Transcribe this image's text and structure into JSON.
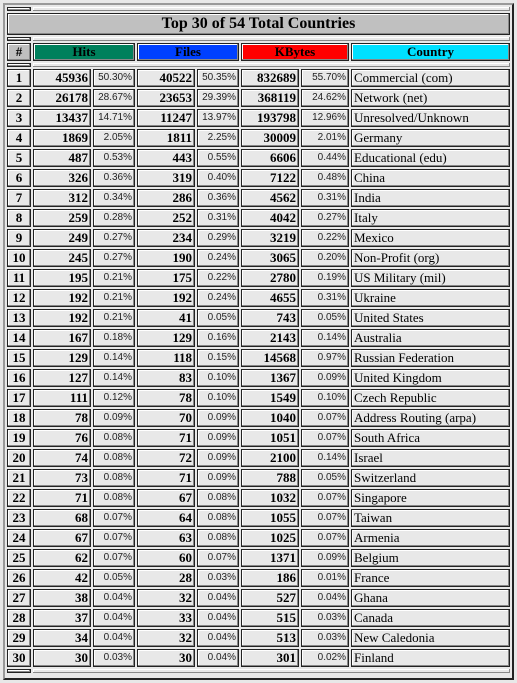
{
  "title": "Top 30 of 54 Total Countries",
  "headers": {
    "rank": "#",
    "hits": "Hits",
    "files": "Files",
    "kbytes": "KBytes",
    "country": "Country"
  },
  "colors": {
    "title_bg": "#C0C0C0",
    "hits": "#00805C",
    "files": "#0040FF",
    "kbytes": "#FF0000",
    "country": "#00E0FF"
  },
  "rows": [
    {
      "rank": "1",
      "hits": "45936",
      "hits_pct": "50.30%",
      "files": "40522",
      "files_pct": "50.35%",
      "kbytes": "832689",
      "kbytes_pct": "55.70%",
      "country": "Commercial (com)"
    },
    {
      "rank": "2",
      "hits": "26178",
      "hits_pct": "28.67%",
      "files": "23653",
      "files_pct": "29.39%",
      "kbytes": "368119",
      "kbytes_pct": "24.62%",
      "country": "Network (net)"
    },
    {
      "rank": "3",
      "hits": "13437",
      "hits_pct": "14.71%",
      "files": "11247",
      "files_pct": "13.97%",
      "kbytes": "193798",
      "kbytes_pct": "12.96%",
      "country": "Unresolved/Unknown"
    },
    {
      "rank": "4",
      "hits": "1869",
      "hits_pct": "2.05%",
      "files": "1811",
      "files_pct": "2.25%",
      "kbytes": "30009",
      "kbytes_pct": "2.01%",
      "country": "Germany"
    },
    {
      "rank": "5",
      "hits": "487",
      "hits_pct": "0.53%",
      "files": "443",
      "files_pct": "0.55%",
      "kbytes": "6606",
      "kbytes_pct": "0.44%",
      "country": "Educational (edu)"
    },
    {
      "rank": "6",
      "hits": "326",
      "hits_pct": "0.36%",
      "files": "319",
      "files_pct": "0.40%",
      "kbytes": "7122",
      "kbytes_pct": "0.48%",
      "country": "China"
    },
    {
      "rank": "7",
      "hits": "312",
      "hits_pct": "0.34%",
      "files": "286",
      "files_pct": "0.36%",
      "kbytes": "4562",
      "kbytes_pct": "0.31%",
      "country": "India"
    },
    {
      "rank": "8",
      "hits": "259",
      "hits_pct": "0.28%",
      "files": "252",
      "files_pct": "0.31%",
      "kbytes": "4042",
      "kbytes_pct": "0.27%",
      "country": "Italy"
    },
    {
      "rank": "9",
      "hits": "249",
      "hits_pct": "0.27%",
      "files": "234",
      "files_pct": "0.29%",
      "kbytes": "3219",
      "kbytes_pct": "0.22%",
      "country": "Mexico"
    },
    {
      "rank": "10",
      "hits": "245",
      "hits_pct": "0.27%",
      "files": "190",
      "files_pct": "0.24%",
      "kbytes": "3065",
      "kbytes_pct": "0.20%",
      "country": "Non-Profit (org)"
    },
    {
      "rank": "11",
      "hits": "195",
      "hits_pct": "0.21%",
      "files": "175",
      "files_pct": "0.22%",
      "kbytes": "2780",
      "kbytes_pct": "0.19%",
      "country": "US Military (mil)"
    },
    {
      "rank": "12",
      "hits": "192",
      "hits_pct": "0.21%",
      "files": "192",
      "files_pct": "0.24%",
      "kbytes": "4655",
      "kbytes_pct": "0.31%",
      "country": "Ukraine"
    },
    {
      "rank": "13",
      "hits": "192",
      "hits_pct": "0.21%",
      "files": "41",
      "files_pct": "0.05%",
      "kbytes": "743",
      "kbytes_pct": "0.05%",
      "country": "United States"
    },
    {
      "rank": "14",
      "hits": "167",
      "hits_pct": "0.18%",
      "files": "129",
      "files_pct": "0.16%",
      "kbytes": "2143",
      "kbytes_pct": "0.14%",
      "country": "Australia"
    },
    {
      "rank": "15",
      "hits": "129",
      "hits_pct": "0.14%",
      "files": "118",
      "files_pct": "0.15%",
      "kbytes": "14568",
      "kbytes_pct": "0.97%",
      "country": "Russian Federation"
    },
    {
      "rank": "16",
      "hits": "127",
      "hits_pct": "0.14%",
      "files": "83",
      "files_pct": "0.10%",
      "kbytes": "1367",
      "kbytes_pct": "0.09%",
      "country": "United Kingdom"
    },
    {
      "rank": "17",
      "hits": "111",
      "hits_pct": "0.12%",
      "files": "78",
      "files_pct": "0.10%",
      "kbytes": "1549",
      "kbytes_pct": "0.10%",
      "country": "Czech Republic"
    },
    {
      "rank": "18",
      "hits": "78",
      "hits_pct": "0.09%",
      "files": "70",
      "files_pct": "0.09%",
      "kbytes": "1040",
      "kbytes_pct": "0.07%",
      "country": "Address Routing (arpa)"
    },
    {
      "rank": "19",
      "hits": "76",
      "hits_pct": "0.08%",
      "files": "71",
      "files_pct": "0.09%",
      "kbytes": "1051",
      "kbytes_pct": "0.07%",
      "country": "South Africa"
    },
    {
      "rank": "20",
      "hits": "74",
      "hits_pct": "0.08%",
      "files": "72",
      "files_pct": "0.09%",
      "kbytes": "2100",
      "kbytes_pct": "0.14%",
      "country": "Israel"
    },
    {
      "rank": "21",
      "hits": "73",
      "hits_pct": "0.08%",
      "files": "71",
      "files_pct": "0.09%",
      "kbytes": "788",
      "kbytes_pct": "0.05%",
      "country": "Switzerland"
    },
    {
      "rank": "22",
      "hits": "71",
      "hits_pct": "0.08%",
      "files": "67",
      "files_pct": "0.08%",
      "kbytes": "1032",
      "kbytes_pct": "0.07%",
      "country": "Singapore"
    },
    {
      "rank": "23",
      "hits": "68",
      "hits_pct": "0.07%",
      "files": "64",
      "files_pct": "0.08%",
      "kbytes": "1055",
      "kbytes_pct": "0.07%",
      "country": "Taiwan"
    },
    {
      "rank": "24",
      "hits": "67",
      "hits_pct": "0.07%",
      "files": "63",
      "files_pct": "0.08%",
      "kbytes": "1025",
      "kbytes_pct": "0.07%",
      "country": "Armenia"
    },
    {
      "rank": "25",
      "hits": "62",
      "hits_pct": "0.07%",
      "files": "60",
      "files_pct": "0.07%",
      "kbytes": "1371",
      "kbytes_pct": "0.09%",
      "country": "Belgium"
    },
    {
      "rank": "26",
      "hits": "42",
      "hits_pct": "0.05%",
      "files": "28",
      "files_pct": "0.03%",
      "kbytes": "186",
      "kbytes_pct": "0.01%",
      "country": "France"
    },
    {
      "rank": "27",
      "hits": "38",
      "hits_pct": "0.04%",
      "files": "32",
      "files_pct": "0.04%",
      "kbytes": "527",
      "kbytes_pct": "0.04%",
      "country": "Ghana"
    },
    {
      "rank": "28",
      "hits": "37",
      "hits_pct": "0.04%",
      "files": "33",
      "files_pct": "0.04%",
      "kbytes": "515",
      "kbytes_pct": "0.03%",
      "country": "Canada"
    },
    {
      "rank": "29",
      "hits": "34",
      "hits_pct": "0.04%",
      "files": "32",
      "files_pct": "0.04%",
      "kbytes": "513",
      "kbytes_pct": "0.03%",
      "country": "New Caledonia"
    },
    {
      "rank": "30",
      "hits": "30",
      "hits_pct": "0.03%",
      "files": "30",
      "files_pct": "0.04%",
      "kbytes": "301",
      "kbytes_pct": "0.02%",
      "country": "Finland"
    }
  ]
}
